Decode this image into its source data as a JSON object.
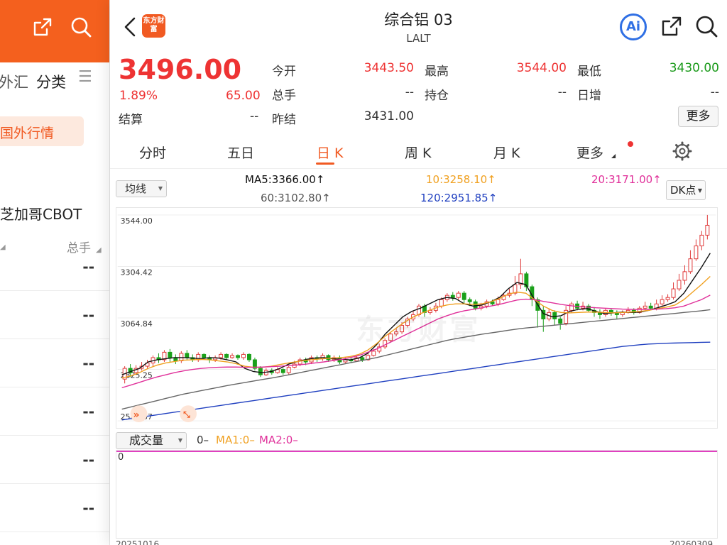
{
  "left_panel": {
    "tabs": [
      "外汇",
      "分类",
      "☰"
    ],
    "chip": "国外行情",
    "exchange": "芝加哥CBOT",
    "col_header": "总手",
    "rows": [
      "--",
      "--",
      "--",
      "--",
      "--",
      "--"
    ]
  },
  "header": {
    "title": "综合铝 03",
    "code": "LALT",
    "logo_text": "东方财富",
    "ai_label": "Ai"
  },
  "quote": {
    "price": "3496.00",
    "pct": "1.89%",
    "change": "65.00",
    "settle_label": "结算",
    "settle_value": "--",
    "fields": [
      {
        "label": "今开",
        "value": "3443.50",
        "color": "#e33"
      },
      {
        "label": "最高",
        "value": "3544.00",
        "color": "#e33"
      },
      {
        "label": "最低",
        "value": "3430.00",
        "color": "#1a9a1a"
      },
      {
        "label": "总手",
        "value": "--",
        "color": "#333"
      },
      {
        "label": "持仓",
        "value": "--",
        "color": "#333"
      },
      {
        "label": "日增",
        "value": "--",
        "color": "#333"
      },
      {
        "label": "昨结",
        "value": "3431.00",
        "color": "#333"
      }
    ],
    "more_label": "更多"
  },
  "tabs": [
    "分时",
    "五日",
    "日 K",
    "周 K",
    "月 K",
    "更多"
  ],
  "active_tab": "日 K",
  "ma": {
    "selector": "均线",
    "ma5": "MA5:3366.00↑",
    "ma10": "10:3258.10↑",
    "ma20": "20:3171.00↑",
    "ma60": "60:3102.80↑",
    "ma120": "120:2951.85↑",
    "dk": "DK点"
  },
  "colors": {
    "up": "#e03a3a",
    "down": "#1aa01a",
    "ma5": "#111111",
    "ma10": "#f0a020",
    "ma20": "#e0309a",
    "ma60": "#666666",
    "ma120": "#2040c0"
  },
  "watermark": "东方财富",
  "volume": {
    "selector": "成交量",
    "v0": "0–",
    "ma1": "MA1:0–",
    "ma2": "MA2:0–",
    "zero": "0"
  },
  "dates": {
    "start": "20251016",
    "end": "20260309"
  },
  "chart_data": {
    "type": "candlestick",
    "y_ticks": [
      "3544.00",
      "3304.42",
      "3064.84",
      "2825.25",
      "2585.67"
    ],
    "ylim": [
      2585.67,
      3544.0
    ],
    "grid": true,
    "x_start": "20251016",
    "x_end": "20260309",
    "candles": [
      [
        2780,
        2830,
        2760,
        2840
      ],
      [
        2830,
        2810,
        2790,
        2850
      ],
      [
        2810,
        2830,
        2800,
        2845
      ],
      [
        2830,
        2840,
        2820,
        2860
      ],
      [
        2840,
        2855,
        2830,
        2870
      ],
      [
        2855,
        2880,
        2840,
        2890
      ],
      [
        2880,
        2870,
        2855,
        2900
      ],
      [
        2870,
        2905,
        2860,
        2915
      ],
      [
        2905,
        2880,
        2860,
        2920
      ],
      [
        2880,
        2865,
        2850,
        2895
      ],
      [
        2865,
        2900,
        2855,
        2910
      ],
      [
        2900,
        2880,
        2870,
        2915
      ],
      [
        2880,
        2870,
        2860,
        2895
      ],
      [
        2870,
        2895,
        2860,
        2905
      ],
      [
        2895,
        2880,
        2870,
        2900
      ],
      [
        2880,
        2870,
        2855,
        2890
      ],
      [
        2870,
        2880,
        2860,
        2890
      ],
      [
        2880,
        2895,
        2870,
        2905
      ],
      [
        2895,
        2880,
        2870,
        2900
      ],
      [
        2880,
        2890,
        2875,
        2900
      ],
      [
        2890,
        2880,
        2870,
        2895
      ],
      [
        2880,
        2895,
        2870,
        2905
      ],
      [
        2895,
        2870,
        2860,
        2900
      ],
      [
        2870,
        2830,
        2820,
        2880
      ],
      [
        2830,
        2800,
        2790,
        2840
      ],
      [
        2800,
        2820,
        2795,
        2830
      ],
      [
        2820,
        2810,
        2800,
        2830
      ],
      [
        2810,
        2825,
        2805,
        2835
      ],
      [
        2825,
        2810,
        2800,
        2830
      ],
      [
        2810,
        2835,
        2800,
        2845
      ],
      [
        2835,
        2850,
        2830,
        2865
      ],
      [
        2850,
        2870,
        2840,
        2880
      ],
      [
        2870,
        2860,
        2845,
        2880
      ],
      [
        2860,
        2880,
        2850,
        2890
      ],
      [
        2880,
        2875,
        2860,
        2890
      ],
      [
        2875,
        2890,
        2865,
        2900
      ],
      [
        2890,
        2870,
        2860,
        2895
      ],
      [
        2870,
        2880,
        2860,
        2890
      ],
      [
        2880,
        2860,
        2850,
        2890
      ],
      [
        2860,
        2870,
        2855,
        2880
      ],
      [
        2870,
        2865,
        2855,
        2880
      ],
      [
        2865,
        2880,
        2860,
        2890
      ],
      [
        2880,
        2870,
        2860,
        2890
      ],
      [
        2870,
        2890,
        2865,
        2900
      ],
      [
        2890,
        2910,
        2885,
        2920
      ],
      [
        2910,
        2930,
        2900,
        2945
      ],
      [
        2930,
        2960,
        2920,
        2970
      ],
      [
        2960,
        2990,
        2950,
        3000
      ],
      [
        2990,
        3000,
        2980,
        3020
      ],
      [
        3000,
        3030,
        2990,
        3045
      ],
      [
        3030,
        3060,
        3020,
        3070
      ],
      [
        3060,
        3080,
        3050,
        3100
      ],
      [
        3080,
        3120,
        3070,
        3130
      ],
      [
        3120,
        3090,
        3070,
        3130
      ],
      [
        3090,
        3100,
        3080,
        3115
      ],
      [
        3100,
        3120,
        3090,
        3135
      ],
      [
        3120,
        3150,
        3110,
        3160
      ],
      [
        3150,
        3170,
        3140,
        3180
      ],
      [
        3170,
        3160,
        3145,
        3185
      ],
      [
        3160,
        3180,
        3150,
        3190
      ],
      [
        3180,
        3150,
        3130,
        3190
      ],
      [
        3150,
        3140,
        3120,
        3160
      ],
      [
        3140,
        3110,
        3100,
        3150
      ],
      [
        3110,
        3120,
        3100,
        3135
      ],
      [
        3120,
        3140,
        3110,
        3150
      ],
      [
        3140,
        3130,
        3120,
        3150
      ],
      [
        3130,
        3150,
        3120,
        3165
      ],
      [
        3150,
        3170,
        3145,
        3180
      ],
      [
        3170,
        3180,
        3160,
        3200
      ],
      [
        3180,
        3220,
        3170,
        3260
      ],
      [
        3220,
        3270,
        3200,
        3340
      ],
      [
        3270,
        3210,
        3190,
        3280
      ],
      [
        3210,
        3150,
        3120,
        3220
      ],
      [
        3150,
        3100,
        3020,
        3160
      ],
      [
        3100,
        3060,
        3000,
        3120
      ],
      [
        3060,
        3090,
        3050,
        3110
      ],
      [
        3090,
        3060,
        3030,
        3100
      ],
      [
        3060,
        3040,
        3010,
        3070
      ],
      [
        3040,
        3100,
        3030,
        3120
      ],
      [
        3100,
        3130,
        3090,
        3140
      ],
      [
        3130,
        3110,
        3100,
        3145
      ],
      [
        3110,
        3120,
        3100,
        3140
      ],
      [
        3120,
        3100,
        3090,
        3130
      ],
      [
        3100,
        3090,
        3070,
        3115
      ],
      [
        3090,
        3080,
        3060,
        3105
      ],
      [
        3080,
        3100,
        3070,
        3110
      ],
      [
        3100,
        3090,
        3075,
        3110
      ],
      [
        3090,
        3080,
        3060,
        3100
      ],
      [
        3080,
        3090,
        3070,
        3100
      ],
      [
        3090,
        3100,
        3085,
        3115
      ],
      [
        3100,
        3090,
        3080,
        3110
      ],
      [
        3090,
        3110,
        3085,
        3120
      ],
      [
        3110,
        3120,
        3100,
        3140
      ],
      [
        3120,
        3110,
        3100,
        3135
      ],
      [
        3110,
        3130,
        3100,
        3150
      ],
      [
        3130,
        3150,
        3120,
        3170
      ],
      [
        3150,
        3160,
        3140,
        3175
      ],
      [
        3160,
        3200,
        3150,
        3230
      ],
      [
        3200,
        3240,
        3190,
        3270
      ],
      [
        3240,
        3280,
        3220,
        3310
      ],
      [
        3280,
        3340,
        3270,
        3380
      ],
      [
        3340,
        3400,
        3330,
        3430
      ],
      [
        3400,
        3450,
        3380,
        3470
      ],
      [
        3450,
        3496,
        3430,
        3544
      ]
    ],
    "ma_series": [
      {
        "name": "MA5",
        "values": [
          2800,
          2815,
          2830,
          2860,
          2870,
          2875,
          2880,
          2880,
          2878,
          2875,
          2880,
          2878,
          2870,
          2860,
          2830,
          2815,
          2810,
          2815,
          2830,
          2850,
          2862,
          2872,
          2878,
          2880,
          2875,
          2872,
          2870,
          2878,
          2900,
          2940,
          2990,
          3030,
          3070,
          3095,
          3110,
          3130,
          3150,
          3160,
          3155,
          3130,
          3120,
          3125,
          3140,
          3160,
          3200,
          3230,
          3220,
          3150,
          3085,
          3070,
          3075,
          3095,
          3105,
          3108,
          3095,
          3085,
          3088,
          3092,
          3090,
          3092,
          3100,
          3112,
          3125,
          3140,
          3180,
          3240,
          3300,
          3366
        ]
      },
      {
        "name": "MA10",
        "values": [
          2785,
          2795,
          2810,
          2830,
          2845,
          2855,
          2862,
          2868,
          2870,
          2872,
          2870,
          2865,
          2860,
          2852,
          2840,
          2835,
          2835,
          2840,
          2848,
          2855,
          2862,
          2868,
          2872,
          2875,
          2878,
          2880,
          2885,
          2895,
          2915,
          2945,
          2980,
          3010,
          3040,
          3065,
          3085,
          3100,
          3115,
          3125,
          3130,
          3130,
          3128,
          3130,
          3140,
          3155,
          3175,
          3185,
          3180,
          3150,
          3120,
          3100,
          3090,
          3088,
          3090,
          3092,
          3092,
          3090,
          3088,
          3090,
          3092,
          3095,
          3100,
          3108,
          3115,
          3125,
          3150,
          3185,
          3220,
          3258
        ]
      },
      {
        "name": "MA20",
        "values": [
          2740,
          2752,
          2765,
          2778,
          2790,
          2800,
          2810,
          2818,
          2825,
          2830,
          2833,
          2835,
          2836,
          2836,
          2835,
          2835,
          2836,
          2838,
          2840,
          2843,
          2846,
          2850,
          2855,
          2860,
          2866,
          2872,
          2880,
          2890,
          2905,
          2920,
          2940,
          2960,
          2980,
          3000,
          3020,
          3040,
          3060,
          3075,
          3088,
          3098,
          3105,
          3112,
          3120,
          3128,
          3138,
          3148,
          3152,
          3150,
          3142,
          3135,
          3128,
          3122,
          3118,
          3115,
          3112,
          3110,
          3108,
          3106,
          3105,
          3104,
          3104,
          3106,
          3108,
          3112,
          3120,
          3135,
          3150,
          3171
        ]
      },
      {
        "name": "MA60",
        "values": [
          2640,
          2650,
          2660,
          2670,
          2680,
          2690,
          2700,
          2710,
          2718,
          2726,
          2734,
          2742,
          2750,
          2757,
          2764,
          2771,
          2778,
          2785,
          2792,
          2800,
          2808,
          2816,
          2824,
          2832,
          2840,
          2848,
          2856,
          2864,
          2872,
          2880,
          2890,
          2900,
          2910,
          2920,
          2930,
          2940,
          2950,
          2960,
          2968,
          2975,
          2982,
          2989,
          2995,
          3001,
          3007,
          3013,
          3018,
          3022,
          3026,
          3030,
          3034,
          3038,
          3042,
          3046,
          3050,
          3054,
          3058,
          3062,
          3066,
          3070,
          3074,
          3078,
          3082,
          3086,
          3090,
          3094,
          3098,
          3102.8
        ]
      },
      {
        "name": "MA120",
        "values": [
          2590,
          2596,
          2602,
          2608,
          2614,
          2620,
          2626,
          2632,
          2638,
          2644,
          2650,
          2656,
          2662,
          2668,
          2674,
          2680,
          2686,
          2692,
          2698,
          2704,
          2710,
          2716,
          2722,
          2728,
          2734,
          2740,
          2746,
          2752,
          2758,
          2764,
          2770,
          2776,
          2782,
          2788,
          2794,
          2800,
          2806,
          2812,
          2818,
          2824,
          2830,
          2836,
          2842,
          2848,
          2854,
          2860,
          2866,
          2872,
          2878,
          2884,
          2890,
          2896,
          2902,
          2908,
          2914,
          2920,
          2926,
          2932,
          2936,
          2940,
          2943,
          2945,
          2947,
          2948,
          2949,
          2950,
          2951,
          2951.85
        ]
      }
    ]
  }
}
